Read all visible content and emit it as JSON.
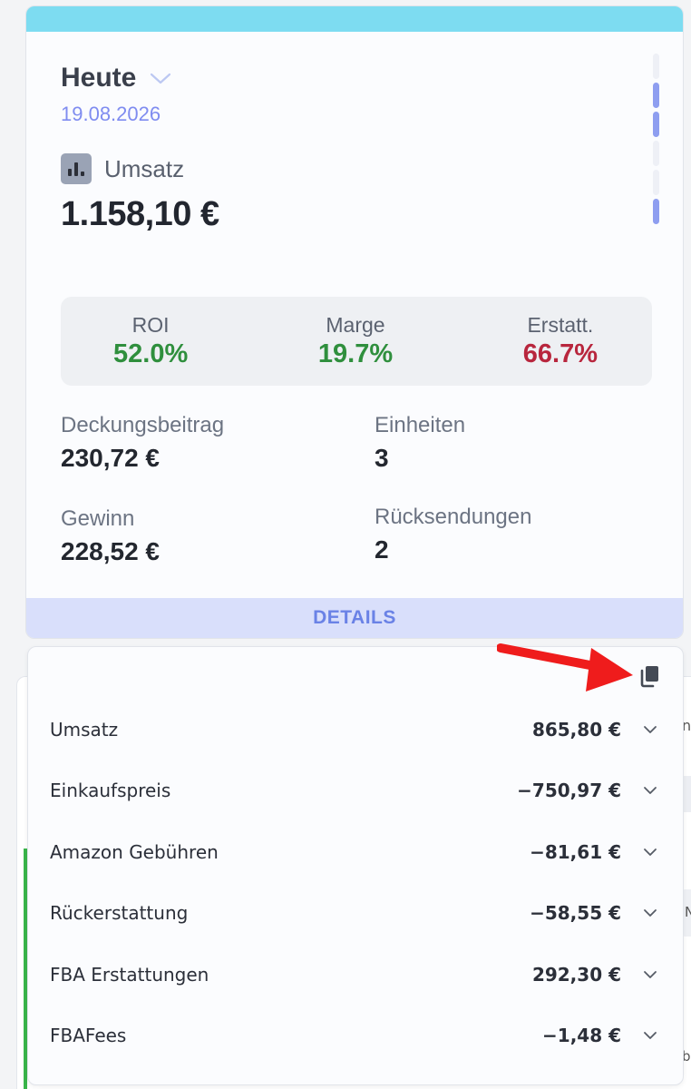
{
  "stats": {
    "period": "Heute",
    "date": "19.08.2026",
    "metric_label": "Umsatz",
    "metric_value": "1.158,10 €",
    "carousel_dots": [
      false,
      true,
      true,
      false,
      false,
      true
    ],
    "kpis": [
      {
        "label": "ROI",
        "value": "52.0%",
        "color": "#2f8f3d"
      },
      {
        "label": "Marge",
        "value": "19.7%",
        "color": "#2f8f3d"
      },
      {
        "label": "Erstatt.",
        "value": "66.7%",
        "color": "#b8263d"
      }
    ],
    "deckungsbeitrag_label": "Deckungsbeitrag",
    "deckungsbeitrag_value": "230,72 €",
    "einheiten_label": "Einheiten",
    "einheiten_value": "3",
    "gewinn_label": "Gewinn",
    "gewinn_value": "228,52 €",
    "ruecksendungen_label": "Rücksendungen",
    "ruecksendungen_value": "2",
    "details_label": "DETAILS"
  },
  "breakdown": {
    "rows": [
      {
        "label": "Umsatz",
        "value": "865,80 €"
      },
      {
        "label": "Einkaufspreis",
        "value": "−750,97 €"
      },
      {
        "label": "Amazon Gebühren",
        "value": "−81,61 €"
      },
      {
        "label": "Rückerstattung",
        "value": "−58,55 €"
      },
      {
        "label": "FBA Erstattungen",
        "value": "292,30 €"
      },
      {
        "label": "FBAFees",
        "value": "−1,48 €"
      }
    ]
  },
  "background": {
    "frag1": "n",
    "frag2": "N",
    "frag3": "b"
  },
  "icons": {
    "copy": "copy-icon",
    "chevron": "chevron-down-icon",
    "chart": "bar-chart-icon",
    "annotation": "red-arrow-icon"
  },
  "colors": {
    "top_bar": "#7ddcf1",
    "accent": "#7f8cf0",
    "positive": "#2f8f3d",
    "negative": "#b8263d",
    "details_bg": "#d9dffb"
  }
}
